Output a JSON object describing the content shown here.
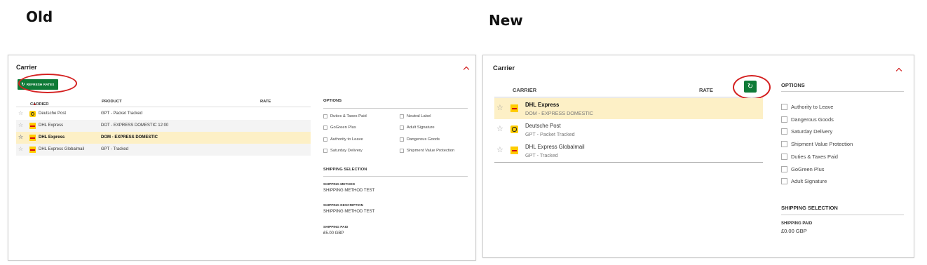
{
  "labels": {
    "old": "Old",
    "new": "New"
  },
  "old": {
    "title": "Carrier",
    "refresh_label": "REFRESH RATES",
    "headers": {
      "carrier": "CARRIER",
      "product": "PRODUCT",
      "rate": "RATE"
    },
    "rows": [
      {
        "carrier": "Deutsche Post",
        "product": "GPT - Packet Tracked",
        "logo": "deutsche-post"
      },
      {
        "carrier": "DHL Express",
        "product": "DOT - EXPRESS DOMESTIC 12:00",
        "logo": "dhl"
      },
      {
        "carrier": "DHL Express",
        "product": "DOM - EXPRESS DOMESTIC",
        "logo": "dhl",
        "selected": true
      },
      {
        "carrier": "DHL Express Globalmail",
        "product": "GPT - Tracked",
        "logo": "dhl"
      }
    ],
    "options_title": "OPTIONS",
    "options_left": [
      "Duties & Taxes Paid",
      "GoGreen Plus",
      "Authority to Leave",
      "Saturday Delivery"
    ],
    "options_right": [
      "Neutral Label",
      "Adult Signature",
      "Dangerous Goods",
      "Shipment Value Protection"
    ],
    "shipping_title": "SHIPPING SELECTION",
    "shipping_method_label": "SHIPPING METHOD",
    "shipping_method_value": "SHIPPING METHOD TEST",
    "shipping_desc_label": "SHIPPING DESCRIPTION",
    "shipping_desc_value": "SHIPPING METHOD TEST",
    "shipping_paid_label": "SHIPPING PAID",
    "shipping_paid_value": "£5.00 GBP"
  },
  "new": {
    "title": "Carrier",
    "headers": {
      "carrier": "CARRIER",
      "rate": "RATE"
    },
    "rows": [
      {
        "carrier": "DHL Express",
        "product": "DOM - EXPRESS DOMESTIC",
        "logo": "dhl",
        "selected": true
      },
      {
        "carrier": "Deutsche Post",
        "product": "GPT - Packet Tracked",
        "logo": "deutsche-post"
      },
      {
        "carrier": "DHL Express Globalmail",
        "product": "GPT - Tracked",
        "logo": "dhl"
      }
    ],
    "options_title": "OPTIONS",
    "options": [
      "Authority to Leave",
      "Dangerous Goods",
      "Saturday Delivery",
      "Shipment Value Protection",
      "Duties & Taxes Paid",
      "GoGreen Plus",
      "Adult Signature"
    ],
    "shipping_title": "SHIPPING SELECTION",
    "shipping_paid_label": "SHIPPING PAID",
    "shipping_paid_value": "£0.00 GBP"
  },
  "colors": {
    "brand_green": "#0e7a36",
    "highlight_red": "#d42020",
    "selected_row": "#fdf0c6",
    "dhl_yellow": "#ffcc00"
  },
  "icons": {
    "star": "star-icon",
    "refresh": "refresh-icon",
    "collapse": "chevron-up-icon"
  }
}
